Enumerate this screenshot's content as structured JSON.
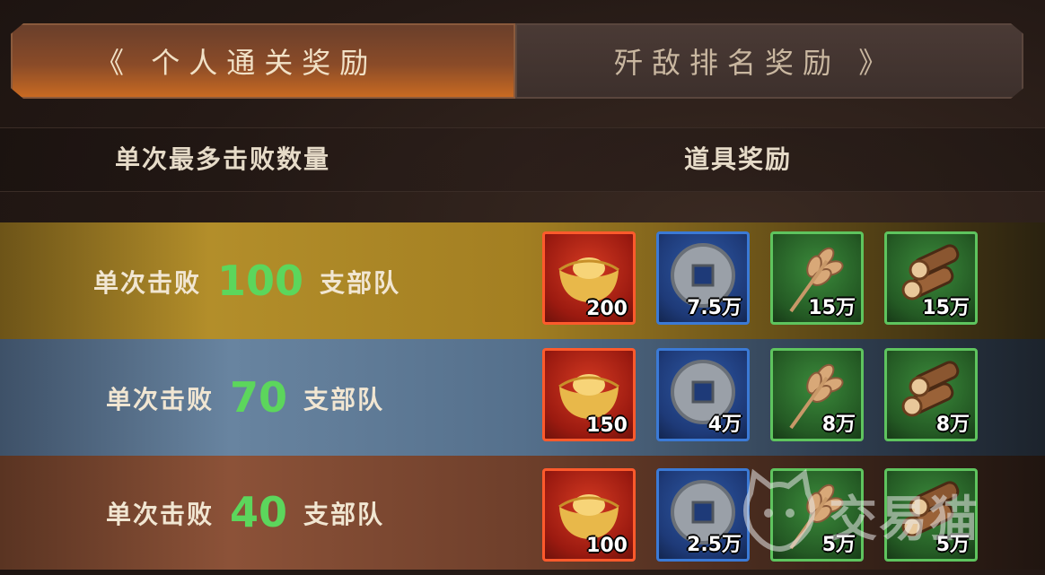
{
  "tabs": {
    "left": {
      "chevron": "《",
      "label": "个人通关奖励"
    },
    "right": {
      "label": "歼敌排名奖励",
      "chevron": "》"
    }
  },
  "header": {
    "col1": "单次最多击败数量",
    "col2": "道具奖励"
  },
  "rows": [
    {
      "prefix": "单次击败",
      "number": "100",
      "suffix": "支部队",
      "rewards": [
        {
          "icon": "gold-ingot-icon",
          "qty": "200"
        },
        {
          "icon": "copper-coin-icon",
          "qty": "7.5万"
        },
        {
          "icon": "wheat-icon",
          "qty": "15万"
        },
        {
          "icon": "wood-logs-icon",
          "qty": "15万"
        }
      ]
    },
    {
      "prefix": "单次击败",
      "number": "70",
      "suffix": "支部队",
      "rewards": [
        {
          "icon": "gold-ingot-icon",
          "qty": "150"
        },
        {
          "icon": "copper-coin-icon",
          "qty": "4万"
        },
        {
          "icon": "wheat-icon",
          "qty": "8万"
        },
        {
          "icon": "wood-logs-icon",
          "qty": "8万"
        }
      ]
    },
    {
      "prefix": "单次击败",
      "number": "40",
      "suffix": "支部队",
      "rewards": [
        {
          "icon": "gold-ingot-icon",
          "qty": "100"
        },
        {
          "icon": "copper-coin-icon",
          "qty": "2.5万"
        },
        {
          "icon": "wheat-icon",
          "qty": "5万"
        },
        {
          "icon": "wood-logs-icon",
          "qty": "5万"
        }
      ]
    }
  ],
  "watermark": {
    "text": "交易猫"
  },
  "colors": {
    "highlight_number": "#5cd65c",
    "tab_active": "#c86a22"
  }
}
